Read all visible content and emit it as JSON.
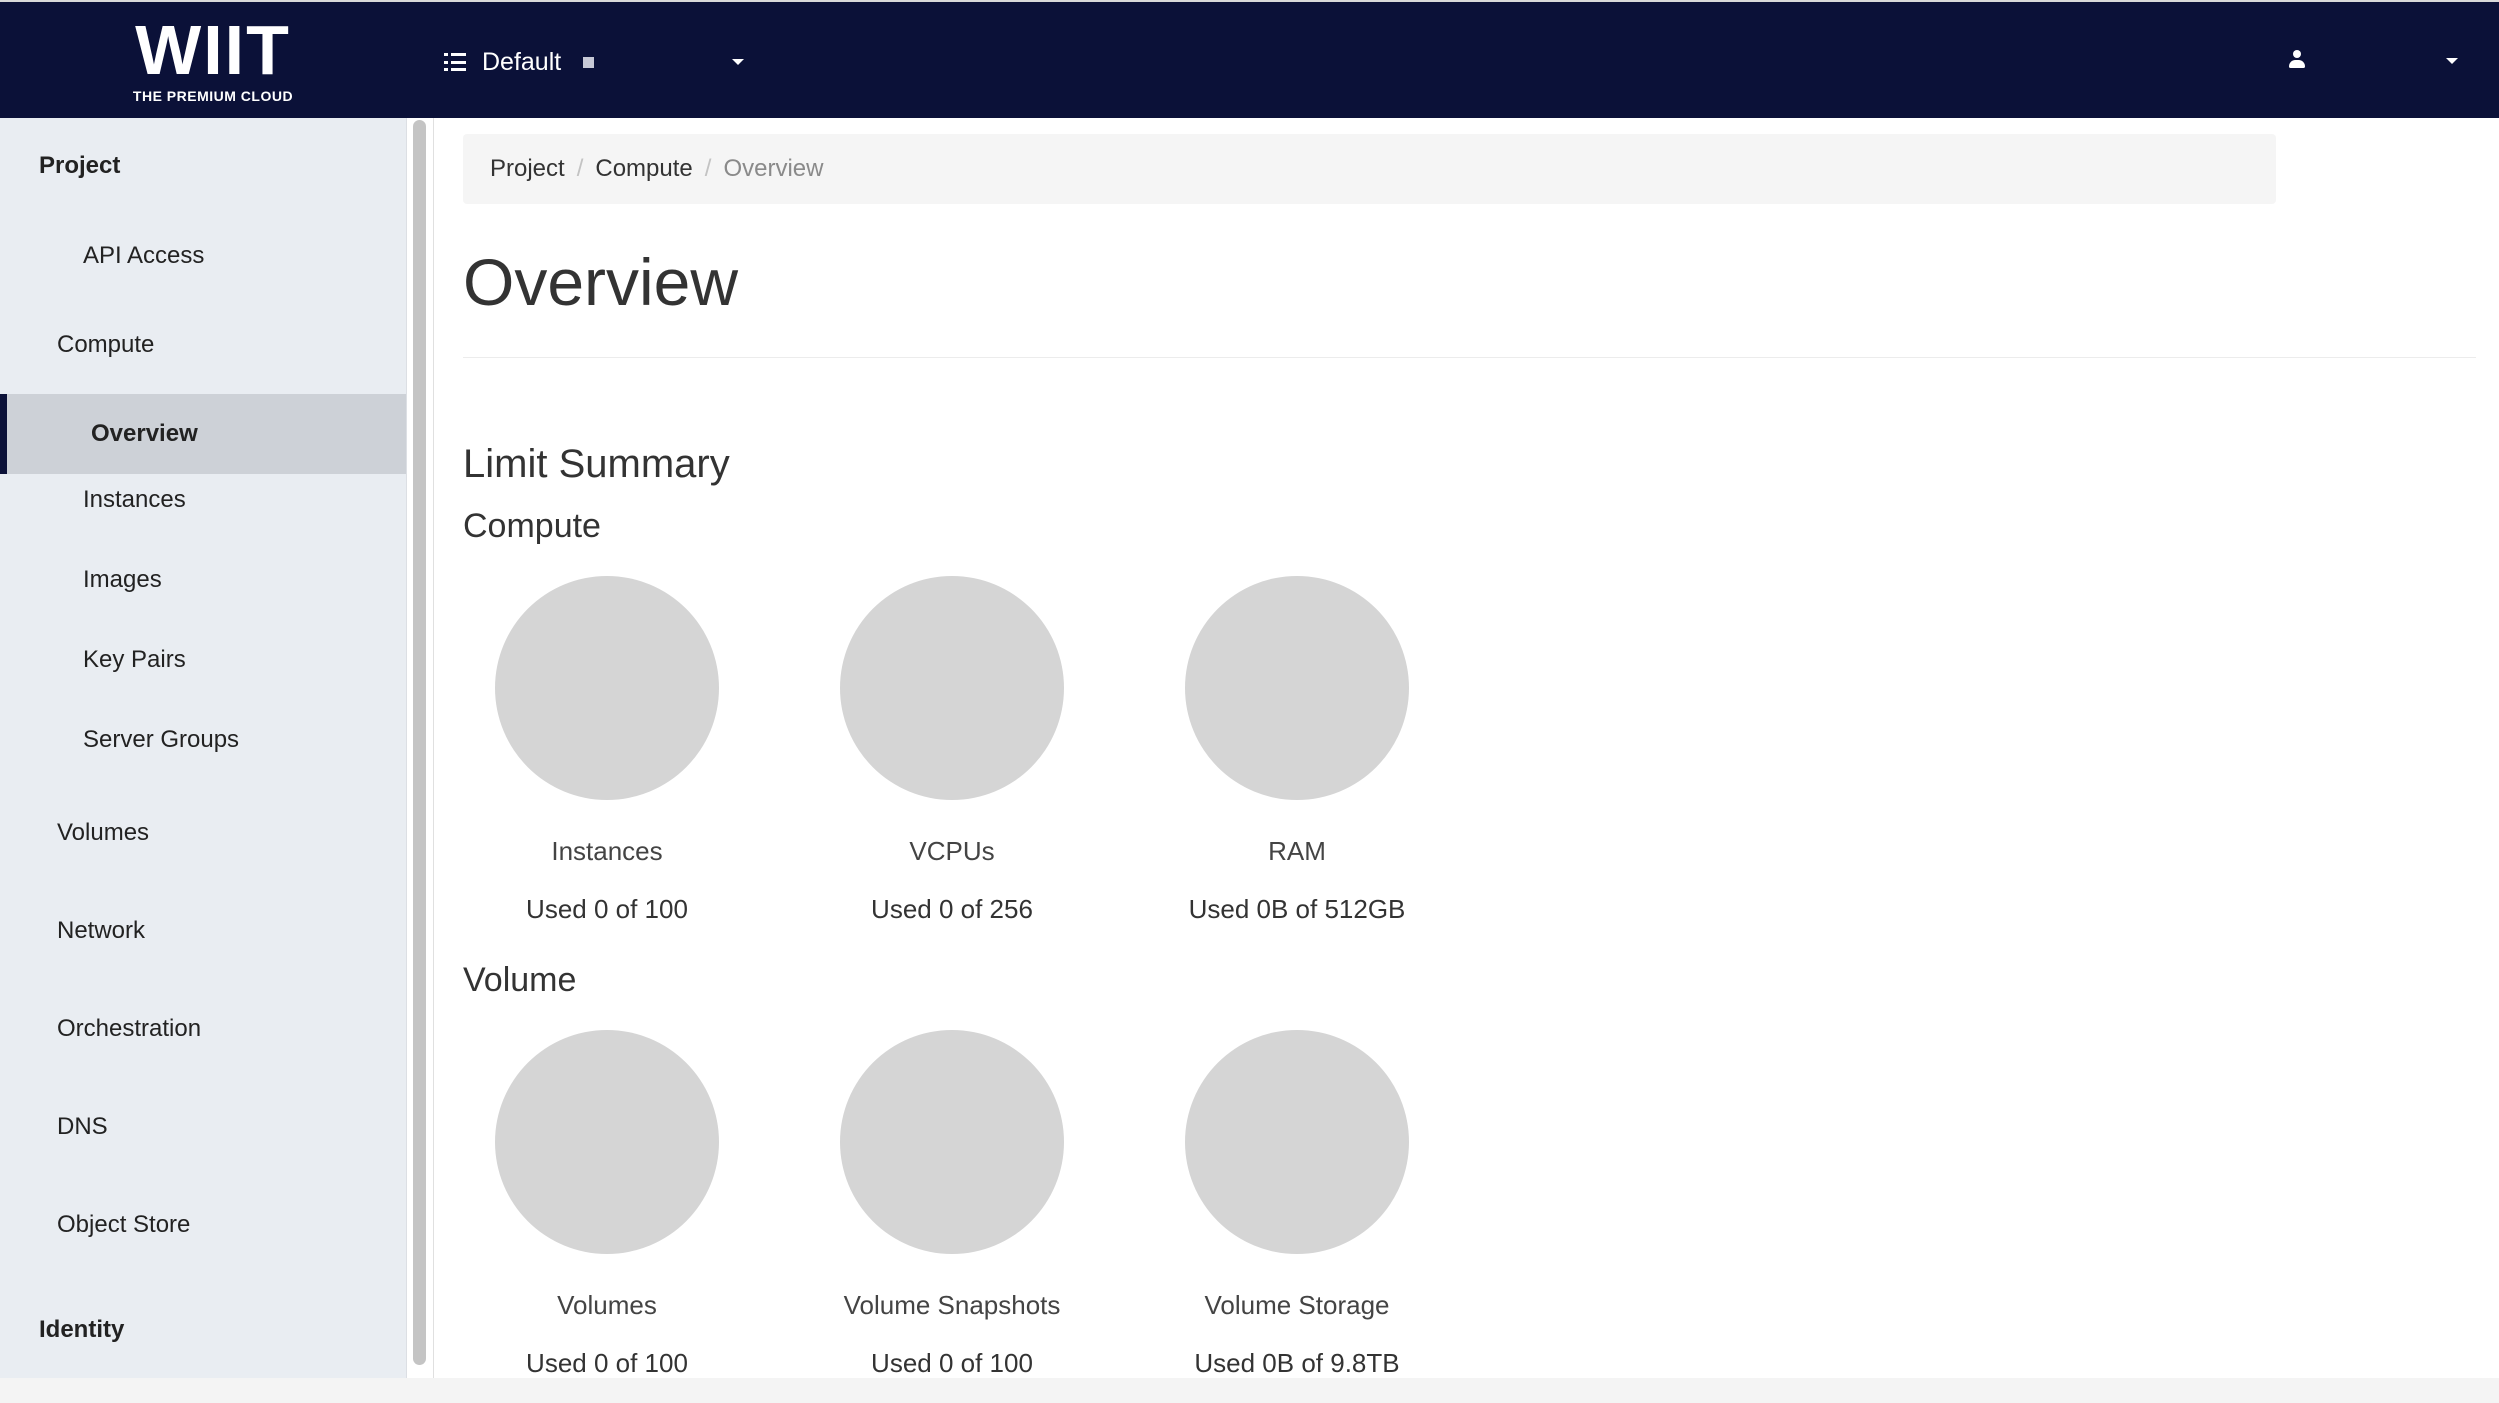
{
  "header": {
    "logo_text": "WIIT",
    "logo_tagline": "THE PREMIUM CLOUD",
    "project_picker_label": "Default",
    "user_menu_label": ""
  },
  "sidebar": {
    "items": [
      {
        "label": "Project",
        "level": 0,
        "section": true
      },
      {
        "label": "API Access",
        "level": 2
      },
      {
        "label": "Compute",
        "level": 1
      },
      {
        "label": "Overview",
        "level": 2,
        "active": true
      },
      {
        "label": "Instances",
        "level": 2
      },
      {
        "label": "Images",
        "level": 2
      },
      {
        "label": "Key Pairs",
        "level": 2
      },
      {
        "label": "Server Groups",
        "level": 2
      },
      {
        "label": "Volumes",
        "level": 1
      },
      {
        "label": "Network",
        "level": 1
      },
      {
        "label": "Orchestration",
        "level": 1
      },
      {
        "label": "DNS",
        "level": 1
      },
      {
        "label": "Object Store",
        "level": 1
      },
      {
        "label": "Identity",
        "level": 0,
        "section": true
      }
    ]
  },
  "breadcrumb": {
    "items": [
      "Project",
      "Compute",
      "Overview"
    ],
    "separator": "/"
  },
  "page": {
    "title": "Overview",
    "limit_summary_heading": "Limit Summary"
  },
  "limits": {
    "compute": {
      "heading": "Compute",
      "charts": [
        {
          "title": "Instances",
          "usage": "Used 0 of 100",
          "used_fraction": 0
        },
        {
          "title": "VCPUs",
          "usage": "Used 0 of 256",
          "used_fraction": 0
        },
        {
          "title": "RAM",
          "usage": "Used 0B of 512GB",
          "used_fraction": 0
        }
      ]
    },
    "volume": {
      "heading": "Volume",
      "charts": [
        {
          "title": "Volumes",
          "usage": "Used 0 of 100",
          "used_fraction": 0
        },
        {
          "title": "Volume Snapshots",
          "usage": "Used 0 of 100",
          "used_fraction": 0
        },
        {
          "title": "Volume Storage",
          "usage": "Used 0B of 9.8TB",
          "used_fraction": 0
        }
      ]
    }
  },
  "colors": {
    "topbar": "#0b1138",
    "sidebar_bg": "#e9edf2",
    "active_item_bg": "#cdd1d7",
    "pie_unused": "#d5d5d5"
  },
  "icons": [
    "list-icon",
    "user-icon",
    "chevron-down-icon"
  ]
}
